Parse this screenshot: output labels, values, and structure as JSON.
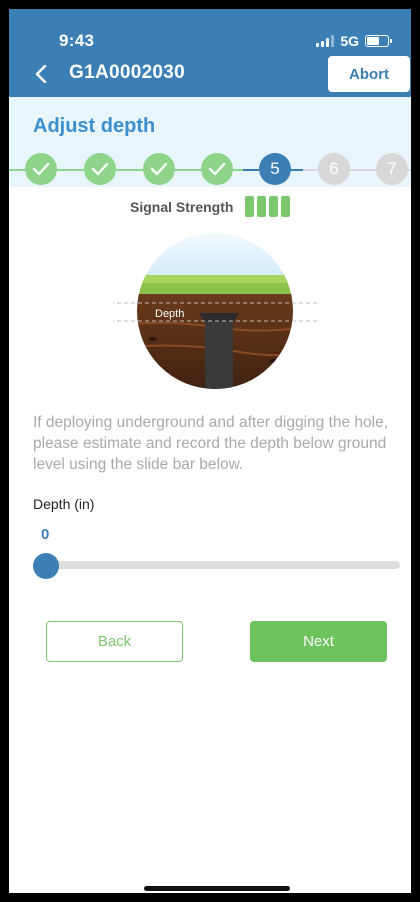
{
  "status_bar": {
    "time": "9:43",
    "network": "5G",
    "signal_bars_filled": 3,
    "signal_bars_total": 4,
    "battery_level": 0.6
  },
  "header": {
    "back_icon": "chevron-left-icon",
    "device_id": "G1A0002030",
    "abort_label": "Abort"
  },
  "page": {
    "title": "Adjust depth"
  },
  "stepper": {
    "current_step": 5,
    "steps": [
      {
        "label": "",
        "state": "done",
        "icon": "check-icon"
      },
      {
        "label": "",
        "state": "done",
        "icon": "check-icon"
      },
      {
        "label": "",
        "state": "done",
        "icon": "check-icon"
      },
      {
        "label": "",
        "state": "done",
        "icon": "check-icon"
      },
      {
        "label": "5",
        "state": "current"
      },
      {
        "label": "6",
        "state": "todo"
      },
      {
        "label": "7",
        "state": "todo"
      }
    ]
  },
  "signal": {
    "label": "Signal Strength",
    "bars": 4
  },
  "illustration": {
    "depth_label": "Depth"
  },
  "instructions": "If deploying underground and after digging the hole, please estimate and record the depth below ground level using the slide bar below.",
  "depth": {
    "label": "Depth (in)",
    "value": "0"
  },
  "buttons": {
    "back": "Back",
    "next": "Next"
  },
  "colors": {
    "primary": "#3b7fb4",
    "accent_green": "#6ec35f",
    "done_green": "#8ed48a",
    "pending_gray": "#d8d8d8",
    "header_tint": "#e8f5fb"
  }
}
